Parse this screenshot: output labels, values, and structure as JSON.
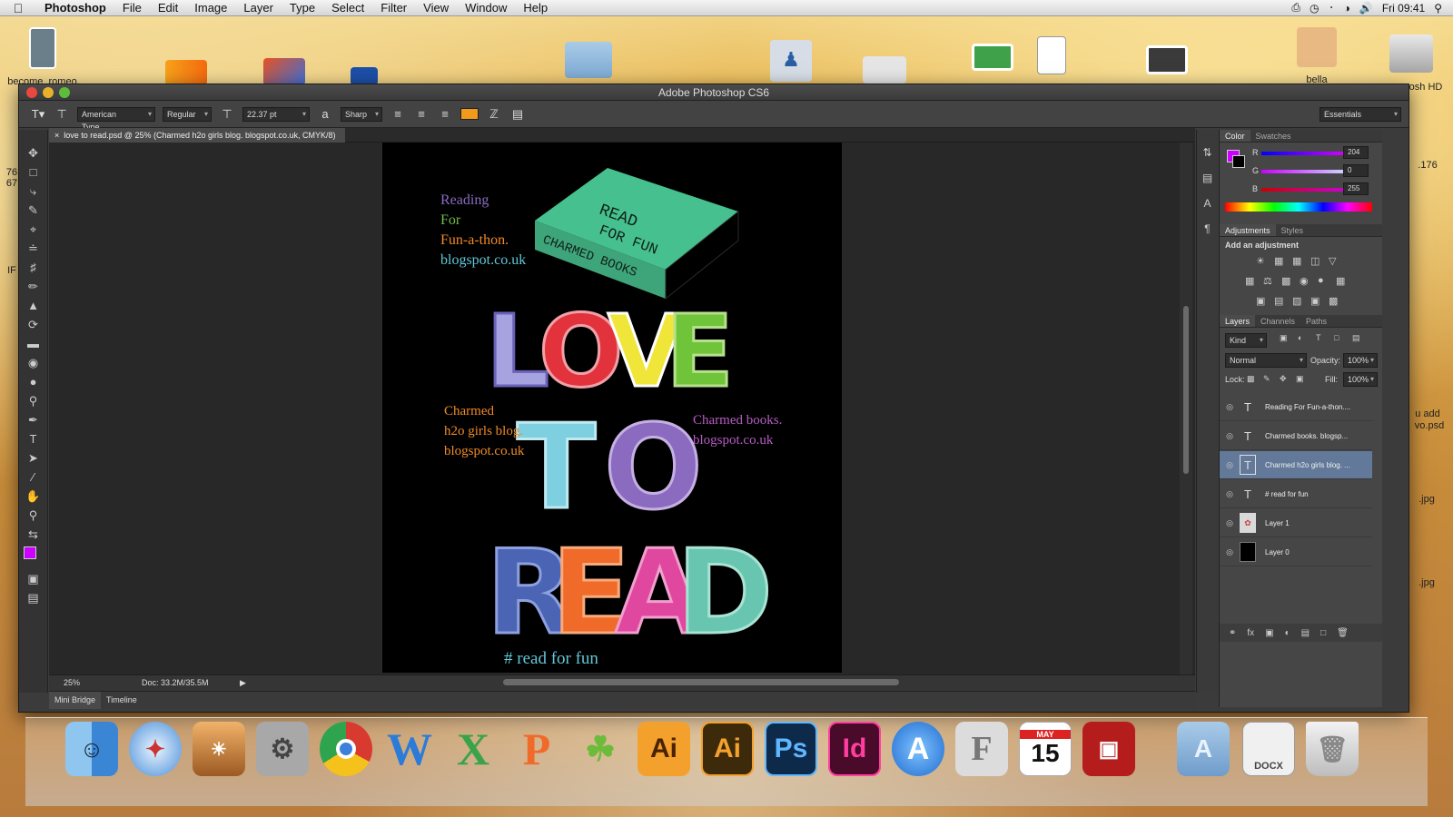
{
  "menubar": {
    "app": "Photoshop",
    "items": [
      "File",
      "Edit",
      "Image",
      "Layer",
      "Type",
      "Select",
      "Filter",
      "View",
      "Window",
      "Help"
    ],
    "clock": "Fri 09:41"
  },
  "desktop": {
    "labels": [
      "become_romeo.",
      "bella",
      "osh HD",
      ".176",
      "u add",
      "vo.psd",
      ".jpg",
      ".jpg",
      "IF",
      "76",
      "67"
    ]
  },
  "window": {
    "title": "Adobe Photoshop CS6",
    "options": {
      "font_family": "American Type...",
      "font_style": "Regular",
      "font_size": "22.37 pt",
      "antialias": "Sharp",
      "workspace": "Essentials",
      "text_color": "#f29a1a"
    },
    "document_tab": "love to read.psd @ 25% (Charmed h2o girls blog. blogspot.co.uk, CMYK/8)",
    "status": {
      "zoom": "25%",
      "doc": "Doc: 33.2M/35.5M"
    },
    "bottom_tabs": [
      "Mini Bridge",
      "Timeline"
    ]
  },
  "poster": {
    "top_left": [
      "Reading",
      "For",
      "Fun-a-thon.",
      "blogspot.co.uk"
    ],
    "book_title_1": "READ",
    "book_title_2": "FOR FUN",
    "book_spine": "CHARMED BOOKS",
    "word_love": [
      "L",
      "O",
      "V",
      "E"
    ],
    "word_to": [
      "T",
      "O"
    ],
    "word_read": [
      "R",
      "E",
      "A",
      "D"
    ],
    "left_text": [
      "Charmed",
      "h2o girls blog.",
      "blogspot.co.uk"
    ],
    "right_text": [
      "Charmed books.",
      "blogspot.co.uk"
    ],
    "hashtag": "# read for fun"
  },
  "color_panel": {
    "tabs": [
      "Color",
      "Swatches"
    ],
    "channels": [
      {
        "label": "R",
        "value": "204"
      },
      {
        "label": "G",
        "value": "0"
      },
      {
        "label": "B",
        "value": "255"
      }
    ],
    "foreground": "#cc00ff"
  },
  "adjustments_panel": {
    "tabs": [
      "Adjustments",
      "Styles"
    ],
    "heading": "Add an adjustment"
  },
  "layers_panel": {
    "tabs": [
      "Layers",
      "Channels",
      "Paths"
    ],
    "filter": "Kind",
    "blend_mode": "Normal",
    "opacity_label": "Opacity:",
    "opacity": "100%",
    "lock_label": "Lock:",
    "fill_label": "Fill:",
    "fill": "100%",
    "layers": [
      {
        "name": "Reading For Fun-a-thon....",
        "type": "text"
      },
      {
        "name": "Charmed books. blogsp...",
        "type": "text"
      },
      {
        "name": "Charmed h2o girls blog. ...",
        "type": "text",
        "selected": true
      },
      {
        "name": "# read for fun",
        "type": "text"
      },
      {
        "name": "Layer 1",
        "type": "image"
      },
      {
        "name": "Layer 0",
        "type": "fill"
      }
    ]
  },
  "dock": {
    "labels": [
      "Ai",
      "Ai",
      "Ps",
      "Id",
      "15",
      "DOCX",
      "MAY"
    ]
  }
}
